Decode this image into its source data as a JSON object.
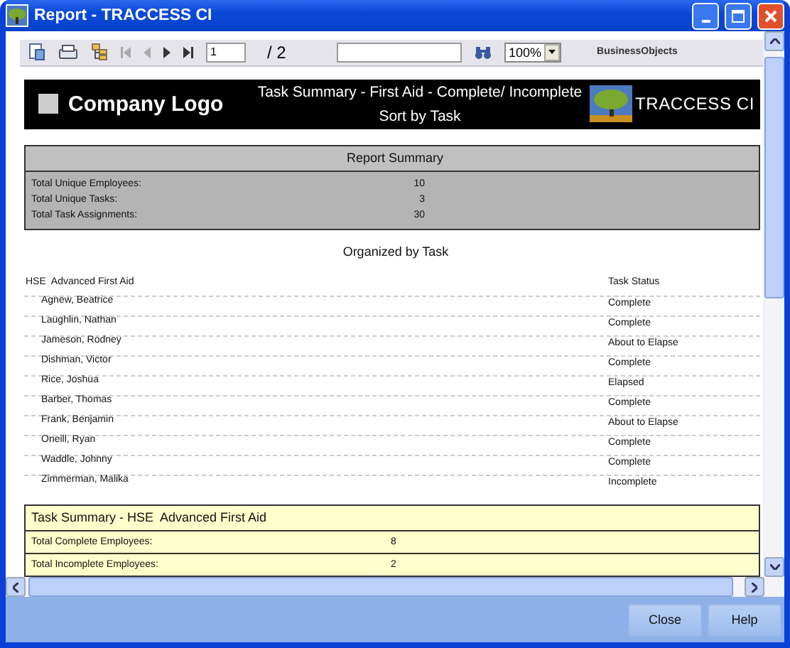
{
  "window": {
    "title": "Report - TRACCESS CI"
  },
  "toolbar": {
    "page": "1",
    "page_total": "/ 2",
    "zoom": "100%",
    "brand": "BusinessObjects"
  },
  "report_header": {
    "logo_text": "Company Logo",
    "title": "Task Summary - First Aid - Complete/ Incomplete",
    "subtitle": "Sort by Task",
    "brand": "TRACCESS CI"
  },
  "report_summary": {
    "title": "Report Summary",
    "rows": [
      {
        "label": "Total Unique Employees:",
        "value": "10"
      },
      {
        "label": "Total Unique Tasks:",
        "value": "3"
      },
      {
        "label": "Total Task Assignments:",
        "value": "30"
      }
    ]
  },
  "section_title": "Organized by Task",
  "task_group": {
    "name": "HSE  Advanced First Aid",
    "status_heading": "Task Status",
    "rows": [
      {
        "employee": "Agnew, Beatrice",
        "status": "Complete"
      },
      {
        "employee": "Laughlin, Nathan",
        "status": "Complete"
      },
      {
        "employee": "Jameson, Rodney",
        "status": "About to Elapse"
      },
      {
        "employee": "Dishman, Victor",
        "status": "Complete"
      },
      {
        "employee": "Rice, Joshua",
        "status": "Elapsed"
      },
      {
        "employee": "Barber, Thomas",
        "status": "Complete"
      },
      {
        "employee": "Frank, Benjamin",
        "status": "About to Elapse"
      },
      {
        "employee": "Oneill, Ryan",
        "status": "Complete"
      },
      {
        "employee": "Waddle, Johnny",
        "status": "Complete"
      },
      {
        "employee": "Zimmerman, Malika",
        "status": "Incomplete"
      }
    ]
  },
  "task_summary": {
    "title": "Task Summary - HSE  Advanced First Aid",
    "rows": [
      {
        "label": "Total Complete Employees:",
        "value": "8"
      },
      {
        "label": "Total Incomplete Employees:",
        "value": "2"
      }
    ]
  },
  "buttons": [
    "Close",
    "Help"
  ]
}
